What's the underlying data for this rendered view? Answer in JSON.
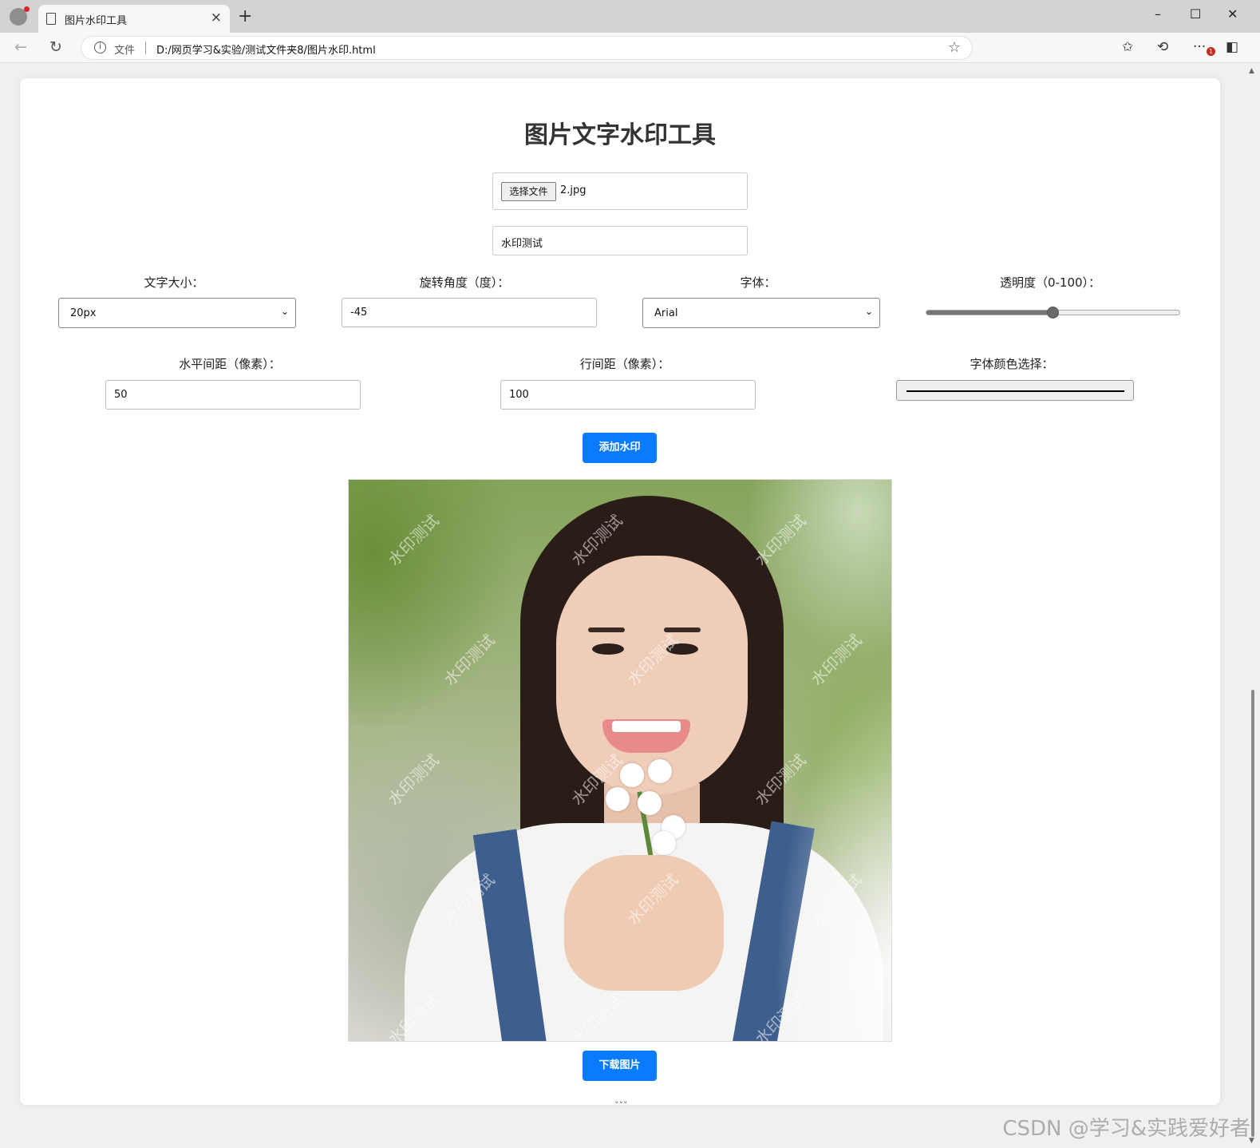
{
  "browser": {
    "tab_title": "图片水印工具",
    "new_tab": "+",
    "close_tab": "×",
    "address_label": "文件",
    "url": "D:/网页学习&实验/测试文件夹8/图片水印.html",
    "badge_count": "1"
  },
  "page": {
    "title": "图片文字水印工具",
    "file_button": "选择文件",
    "file_name": "2.jpg",
    "watermark_text": "水印测试",
    "font_size_label": "文字大小：",
    "font_size_value": "20px",
    "rotation_label": "旋转角度（度）：",
    "rotation_value": "-45",
    "font_label": "字体：",
    "font_value": "Arial",
    "opacity_label": "透明度（0-100）：",
    "opacity_value": 50,
    "h_spacing_label": "水平间距（像素）：",
    "h_spacing_value": "50",
    "line_spacing_label": "行间距（像素）：",
    "line_spacing_value": "100",
    "color_label": "字体颜色选择：",
    "color_value": "#000000",
    "add_button": "添加水印",
    "download_button": "下载图片",
    "bottom_hint": "˅˅˅"
  },
  "overlay": {
    "csdn_mark": "CSDN @学习&实践爱好者"
  },
  "colors": {
    "primary": "#0a7bff",
    "card_bg": "#ffffff",
    "page_bg": "#f0f0f0"
  }
}
